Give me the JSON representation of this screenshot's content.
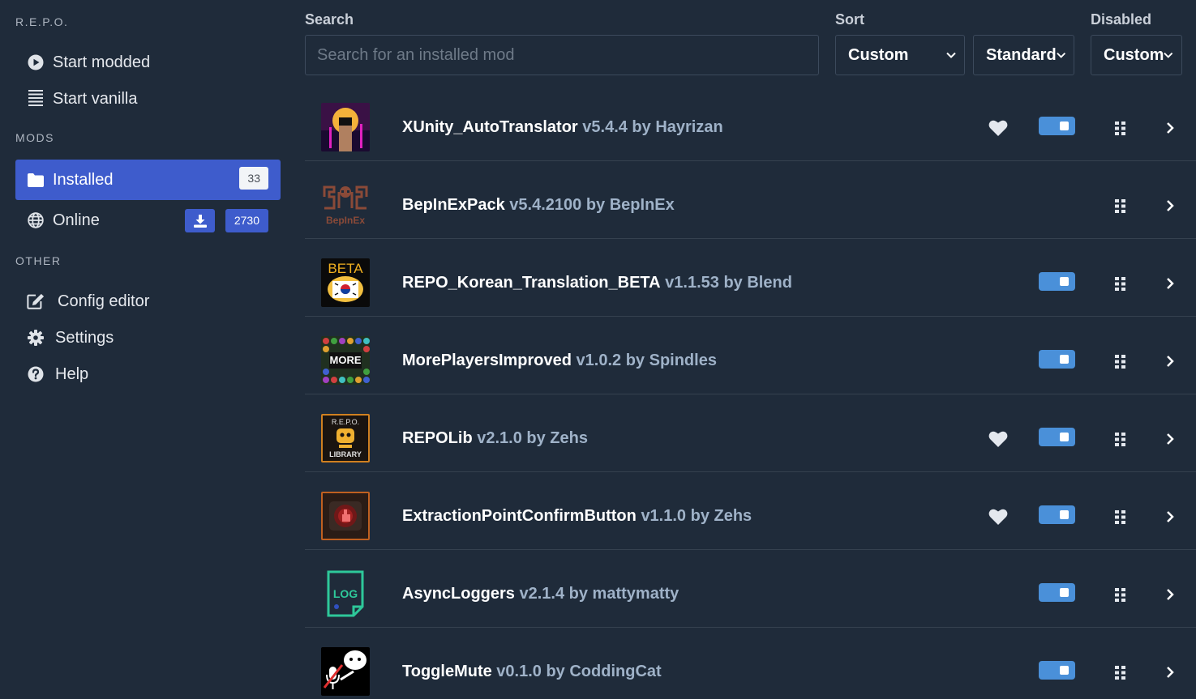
{
  "sidebar": {
    "game_title": "R.E.P.O.",
    "launch_items": [
      {
        "label": "Start modded",
        "icon": "play-circle-icon"
      },
      {
        "label": "Start vanilla",
        "icon": "list-lines-icon"
      }
    ],
    "mods_heading": "MODS",
    "installed": {
      "label": "Installed",
      "count": "33"
    },
    "online": {
      "label": "Online",
      "count": "2730"
    },
    "other_heading": "OTHER",
    "other_items": [
      {
        "label": "Config editor",
        "icon": "edit-icon"
      },
      {
        "label": "Settings",
        "icon": "gear-icon"
      },
      {
        "label": "Help",
        "icon": "question-circle-icon"
      }
    ]
  },
  "toolbar": {
    "search_label": "Search",
    "search_placeholder": "Search for an installed mod",
    "sort_label": "Sort",
    "sort_value": "Custom",
    "order_value": "Standard",
    "disabled_label": "Disabled",
    "disabled_value": "Custom"
  },
  "mods": [
    {
      "name": "XUnity_AutoTranslator",
      "meta": "v5.4.4 by Hayrizan",
      "favorite": true,
      "toggle": true
    },
    {
      "name": "BepInExPack",
      "meta": "v5.4.2100 by BepInEx",
      "favorite": false,
      "toggle": false
    },
    {
      "name": "REPO_Korean_Translation_BETA",
      "meta": "v1.1.53 by Blend",
      "favorite": false,
      "toggle": true
    },
    {
      "name": "MorePlayersImproved",
      "meta": "v1.0.2 by Spindles",
      "favorite": false,
      "toggle": true
    },
    {
      "name": "REPOLib",
      "meta": "v2.1.0 by Zehs",
      "favorite": true,
      "toggle": true
    },
    {
      "name": "ExtractionPointConfirmButton",
      "meta": "v1.1.0 by Zehs",
      "favorite": true,
      "toggle": true
    },
    {
      "name": "AsyncLoggers",
      "meta": "v2.1.4 by mattymatty",
      "favorite": false,
      "toggle": true
    },
    {
      "name": "ToggleMute",
      "meta": "v0.1.0 by CoddingCat",
      "favorite": false,
      "toggle": true
    }
  ],
  "colors": {
    "background": "#1f2b3a",
    "accent": "#3e5ccc",
    "toggle": "#4a90d9",
    "meta_text": "#9fb2c8"
  }
}
